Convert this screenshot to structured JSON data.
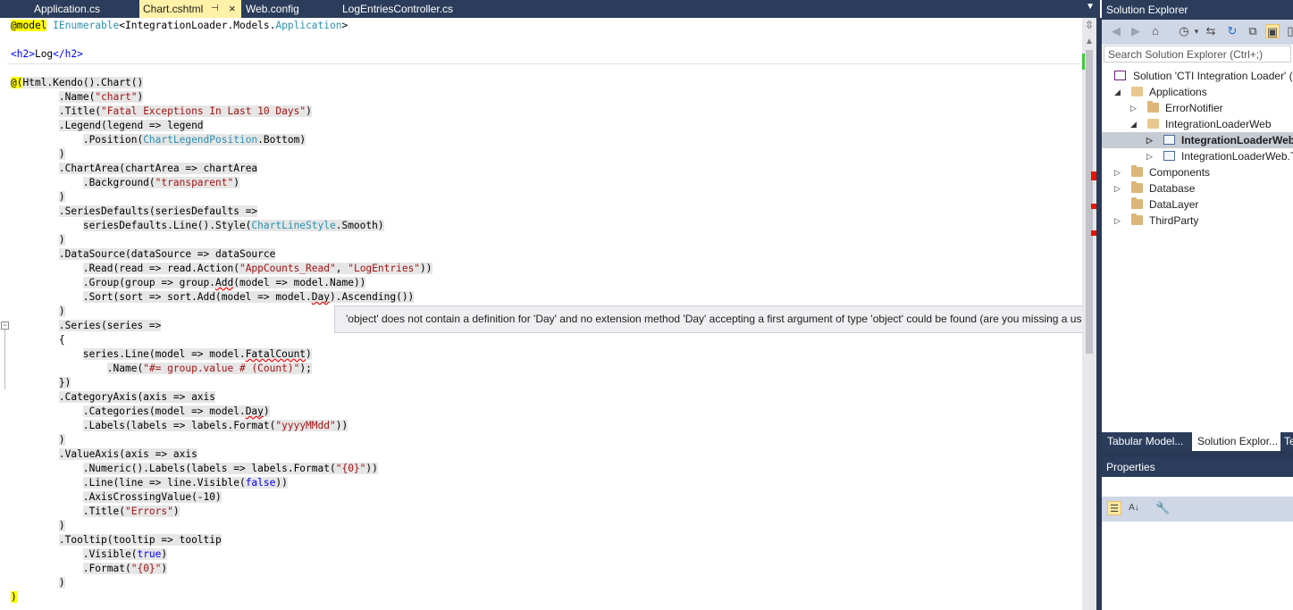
{
  "tabs": [
    {
      "label": "Application.cs",
      "active": false
    },
    {
      "label": "Chart.cshtml",
      "active": true,
      "pin": "⊣",
      "close": "×"
    },
    {
      "label": "Web.config",
      "active": false
    },
    {
      "label": "LogEntriesController.cs",
      "active": false
    }
  ],
  "tab_dropdown_icon": "chevron-down-icon",
  "code": {
    "l1_razor": "@model",
    "l1_type": "IEnumerable",
    "l1_generic_open": "<IntegrationLoader.Models.",
    "l1_generic_type": "Application",
    "l1_generic_close": ">",
    "l2_open": "<h2>",
    "l2_text": "Log",
    "l2_close": "</h2>",
    "l3_at": "@(",
    "l3_rest": "Html.Kendo().Chart()",
    "l4_pre": ".Name(",
    "l4_str": "\"chart\"",
    "l4_post": ")",
    "l5_pre": ".Title(",
    "l5_str": "\"Fatal Exceptions In Last 10 Days\"",
    "l5_post": ")",
    "l6": ".Legend(legend => legend",
    "l7_pre": ".Position(",
    "l7_type": "ChartLegendPosition",
    "l7_post": ".Bottom)",
    "close_paren": ")",
    "l9": ".ChartArea(chartArea => chartArea",
    "l10_pre": ".Background(",
    "l10_str": "\"transparent\"",
    "l10_post": ")",
    "l12": ".SeriesDefaults(seriesDefaults =>",
    "l13_pre": "seriesDefaults.Line().Style(",
    "l13_type": "ChartLineStyle",
    "l13_post": ".Smooth)",
    "l15": ".DataSource(dataSource => dataSource",
    "l16_pre": ".Read(read => read.Action(",
    "l16_s1": "\"AppCounts_Read\"",
    "l16_mid": ", ",
    "l16_s2": "\"LogEntries\"",
    "l16_post": "))",
    "l17_pre": ".Group(group => group.",
    "l17_sq": "Add",
    "l17_post": "(model => model.Name))",
    "l18_pre": ".Sort(sort => sort.Add(model => model.",
    "l18_sq": "Day",
    "l18_post": ").Ascending())",
    "l20": ".Series(series =>",
    "l21": "{",
    "l22_pre": "series.Line(model => model.",
    "l22_sq": "FatalCount",
    "l22_post": ")",
    "l23_pre": ".Name(",
    "l23_str": "\"#= group.value # (Count)\"",
    "l23_post": ");",
    "l24": "})",
    "l25": ".CategoryAxis(axis => axis",
    "l26_pre": ".Categories(model => model.",
    "l26_sq": "Day",
    "l26_post": ")",
    "l27_pre": ".Labels(labels => labels.Format(",
    "l27_str": "\"yyyyMMdd\"",
    "l27_post": "))",
    "l29": ".ValueAxis(axis => axis",
    "l30_pre": ".Numeric().Labels(labels => labels.Format(",
    "l30_str": "\"{0}\"",
    "l30_post": "))",
    "l31_pre": ".Line(line => line.Visible(",
    "l31_kw": "false",
    "l31_post": "))",
    "l32": ".AxisCrossingValue(-10)",
    "l33_pre": ".Title(",
    "l33_str": "\"Errors\"",
    "l33_post": ")",
    "l35": ".Tooltip(tooltip => tooltip",
    "l36_pre": ".Visible(",
    "l36_kw": "true",
    "l36_post": ")",
    "l37_pre": ".Format(",
    "l37_str": "\"{0}\"",
    "l37_post": ")",
    "l40": ")"
  },
  "outline_toggle": "−",
  "tooltip_text": "'object' does not contain a definition for 'Day' and no extension method 'Day' accepting a first argument of type 'object' could be found (are you missing a using directive or an assembly reference?)",
  "scrollbar": {
    "split_icon": "⇳",
    "up_icon": "▲"
  },
  "solution_explorer": {
    "title": "Solution Explorer",
    "search_placeholder": "Search Solution Explorer (Ctrl+;)",
    "tree": [
      {
        "label": "Solution 'CTI Integration Loader' (",
        "level": 0,
        "arrow": "",
        "icon": "solution"
      },
      {
        "label": "Applications",
        "level": 1,
        "arrow": "◢",
        "icon": "folder-open"
      },
      {
        "label": "ErrorNotifier",
        "level": 2,
        "arrow": "▷",
        "icon": "folder"
      },
      {
        "label": "IntegrationLoaderWeb",
        "level": 2,
        "arrow": "◢",
        "icon": "folder-open"
      },
      {
        "label": "IntegrationLoaderWeb",
        "level": 3,
        "arrow": "▷",
        "icon": "project",
        "selected": true
      },
      {
        "label": "IntegrationLoaderWeb.T",
        "level": 3,
        "arrow": "▷",
        "icon": "project"
      },
      {
        "label": "Components",
        "level": 1,
        "arrow": "▷",
        "icon": "folder"
      },
      {
        "label": "Database",
        "level": 1,
        "arrow": "▷",
        "icon": "folder"
      },
      {
        "label": "DataLayer",
        "level": 1,
        "arrow": "",
        "icon": "folder"
      },
      {
        "label": "ThirdParty",
        "level": 1,
        "arrow": "▷",
        "icon": "folder"
      }
    ],
    "bottom_tabs": [
      {
        "label": "Tabular Model...",
        "active": false
      },
      {
        "label": "Solution Explor...",
        "active": true
      },
      {
        "label": "Te",
        "active": false
      }
    ]
  },
  "properties": {
    "title": "Properties",
    "toolbar_icons": [
      "categorized-icon",
      "alphabetical-sort-icon",
      "property-pages-icon"
    ]
  },
  "colors": {
    "chrome": "#2b3d5b",
    "active_tab": "#fff1a8",
    "keyword": "#0000ff",
    "string": "#a31515",
    "type": "#2b91af",
    "error_mark": "#e51400",
    "tooltip_bg": "#efeff2"
  }
}
